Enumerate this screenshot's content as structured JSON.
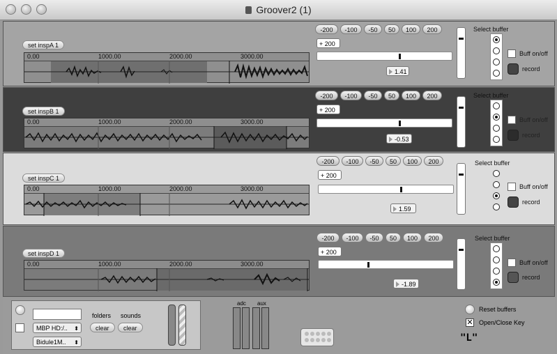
{
  "window": {
    "title": "Groover2 (1)"
  },
  "common": {
    "nudge_buttons": [
      "-200",
      "-100",
      "-50",
      "50",
      "100",
      "200"
    ],
    "plus_value": "+ 200",
    "select_buffer_label": "Select buffer",
    "buff_label": "Buff on/off",
    "record_label": "record",
    "ruler_ticks": [
      "0.00",
      "1000.00",
      "2000.00",
      "3000.00"
    ]
  },
  "panels": [
    {
      "set_label": "set inspA 1",
      "value": "1.41",
      "slider_pct": 0.62,
      "selected_buffer": 1
    },
    {
      "set_label": "set inspB 1",
      "value": "-0.53",
      "slider_pct": 0.62,
      "selected_buffer": 2
    },
    {
      "set_label": "set inspC 1",
      "value": "1.59",
      "slider_pct": 0.62,
      "selected_buffer": 3
    },
    {
      "set_label": "set inspD 1",
      "value": "-1.89",
      "slider_pct": 0.37,
      "selected_buffer": 4
    }
  ],
  "bottom": {
    "drive_select": "MBP HD:/..",
    "bidule_select": "Bidule1M..",
    "folders_label": "folders",
    "sounds_label": "sounds",
    "clear_label": "clear",
    "adc_label": "adc",
    "aux_label": "aux",
    "reset_label": "Reset buffers",
    "openclose_label": "Open/Close Key",
    "key_text": "\"L\""
  }
}
